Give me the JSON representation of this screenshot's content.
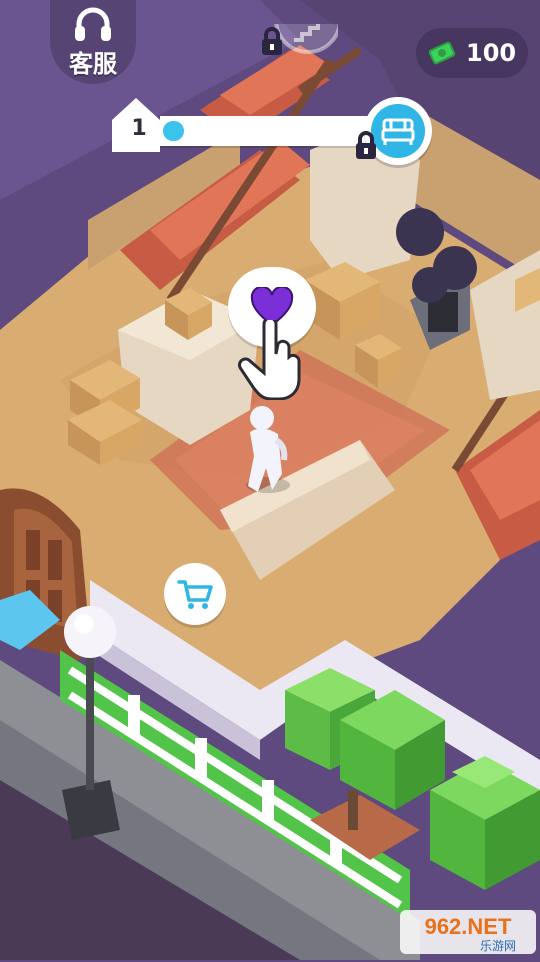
{
  "hud": {
    "support": {
      "label": "客服",
      "icon": "headset-icon"
    },
    "currency": {
      "value": "100",
      "icon": "cash-icon",
      "color": "#3bd35a"
    },
    "level": {
      "number": "1",
      "progress": 0.1,
      "goal_icon": "bed-icon",
      "goal_locked": true
    },
    "stairs": {
      "locked": true,
      "icon": "stairs-icon"
    }
  },
  "bubbles": {
    "heart": {
      "icon": "heart-icon",
      "color": "#7b2fd6"
    },
    "cart": {
      "icon": "shopping-cart-icon",
      "color": "#2fb6e6"
    }
  },
  "watermark": {
    "site": "962.NET",
    "subtitle": "乐游网"
  },
  "colors": {
    "floor": "#d9ad72",
    "wall_dark": "#5a4779",
    "carpet": "#d97b5a",
    "stairs": "#c75b43",
    "accent_blue": "#3cc3ec"
  }
}
